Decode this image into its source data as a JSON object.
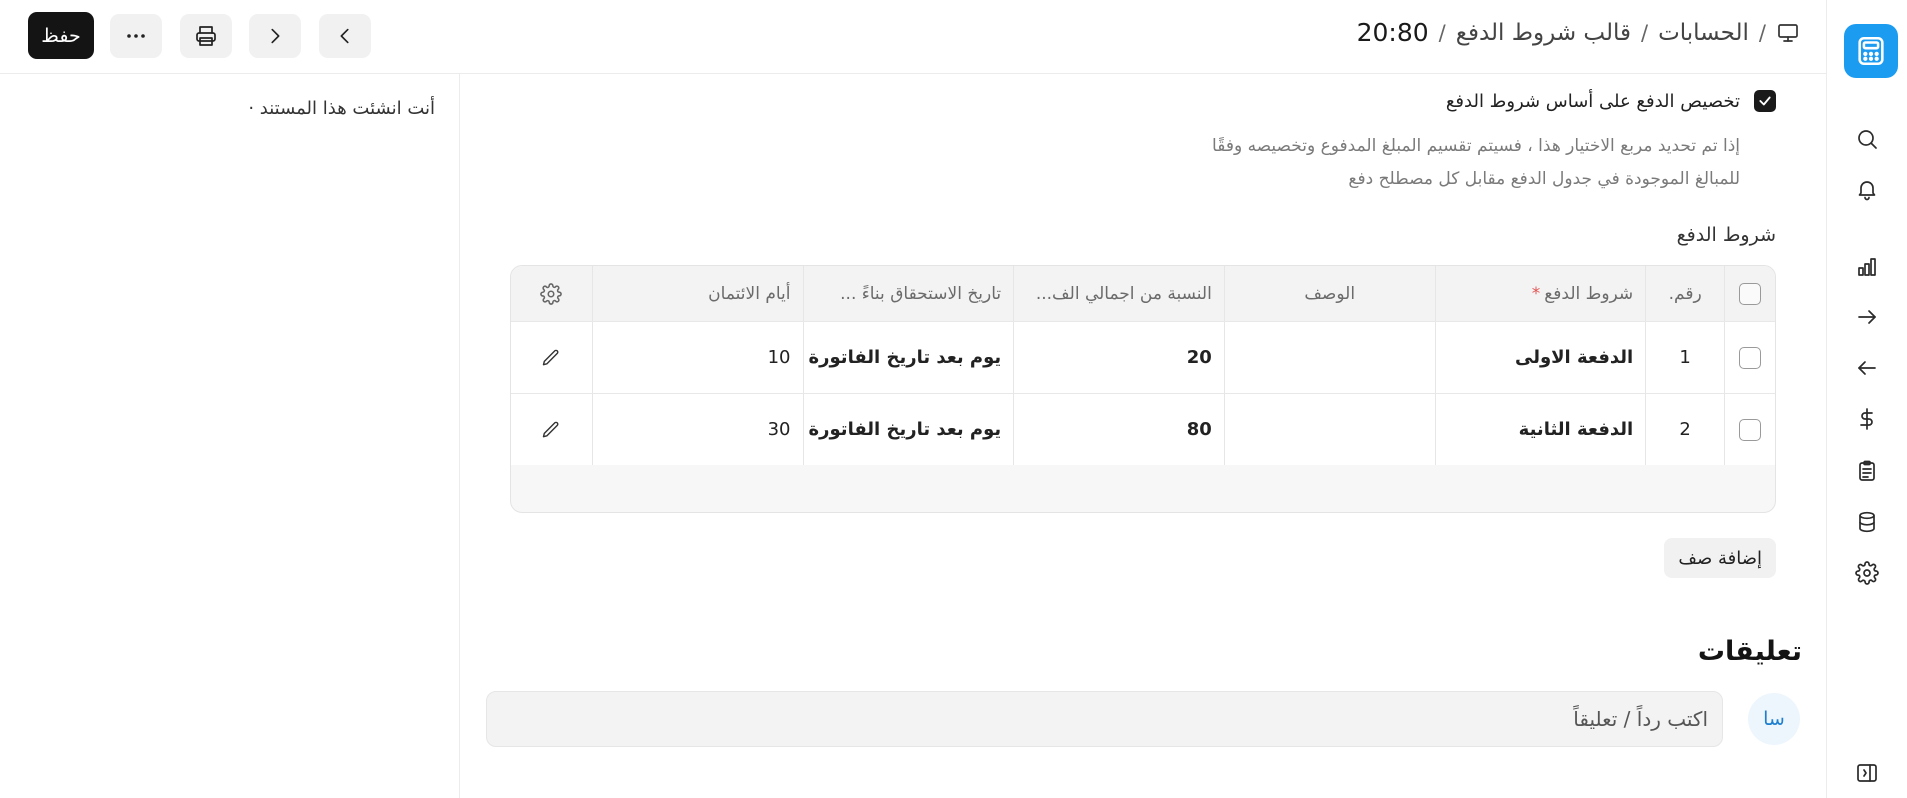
{
  "header": {
    "breadcrumbs": [
      "الحسابات",
      "قالب شروط الدفع"
    ],
    "current": "20:80",
    "separator": "/",
    "save_label": "حفظ"
  },
  "form": {
    "allocate_checkbox_label": "تخصيص الدفع على أساس شروط الدفع",
    "allocate_checked": true,
    "description_line1": "إذا تم تحديد مربع الاختيار هذا ، فسيتم تقسيم المبلغ المدفوع وتخصيصه وفقًا",
    "description_line2": "للمبالغ الموجودة في جدول الدفع مقابل كل مصطلح دفع",
    "table_label": "شروط الدفع"
  },
  "table": {
    "headers": {
      "no": "رقم.",
      "terms": "شروط الدفع",
      "required_mark": "*",
      "description": "الوصف",
      "percent": "النسبة من اجمالي الف...",
      "due_date": "تاريخ الاستحقاق بناءً ...",
      "credit_days": "أيام الائتمان"
    },
    "rows": [
      {
        "no": "1",
        "terms": "الدفعة الاولى",
        "description": "",
        "percent": "20",
        "due_date": "يوم بعد تاريخ الفاتورة",
        "credit_days": "10"
      },
      {
        "no": "2",
        "terms": "الدفعة الثانية",
        "description": "",
        "percent": "80",
        "due_date": "يوم بعد تاريخ الفاتورة",
        "credit_days": "30"
      }
    ],
    "add_row_label": "إضافة صف"
  },
  "comments": {
    "title": "تعليقات",
    "avatar_initials": "سا",
    "placeholder": "اكتب رداً / تعليقاً"
  },
  "activity": {
    "text": "أنت انشئت هذا المستند ·"
  },
  "colors": {
    "brand": "#1c9cf0",
    "save_bg": "#141414",
    "required": "#e25555"
  },
  "icons": {
    "sidebar": [
      "calculator-icon",
      "search-icon",
      "bell-icon",
      "bar-chart-icon",
      "arrow-right-icon",
      "arrow-left-icon",
      "dollar-icon",
      "clipboard-icon",
      "database-icon",
      "gear-icon",
      "sidebar-toggle-icon"
    ]
  }
}
